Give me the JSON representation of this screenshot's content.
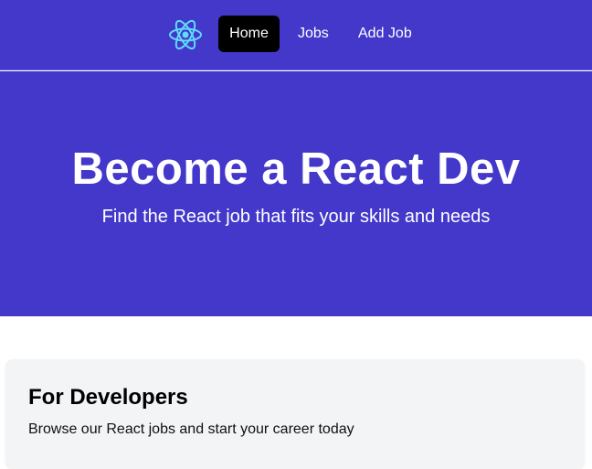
{
  "nav": {
    "logo_icon": "react-atom-icon",
    "links": [
      {
        "label": "Home",
        "active": true
      },
      {
        "label": "Jobs",
        "active": false
      },
      {
        "label": "Add Job",
        "active": false
      }
    ]
  },
  "hero": {
    "title": "Become a React Dev",
    "subtitle": "Find the React job that fits your skills and needs"
  },
  "cards": [
    {
      "title": "For Developers",
      "text": "Browse our React jobs and start your career today"
    }
  ],
  "colors": {
    "primary": "#4338ca",
    "active_link_bg": "#000000",
    "card_bg": "#f3f4f6",
    "logo": "#61dafb"
  }
}
